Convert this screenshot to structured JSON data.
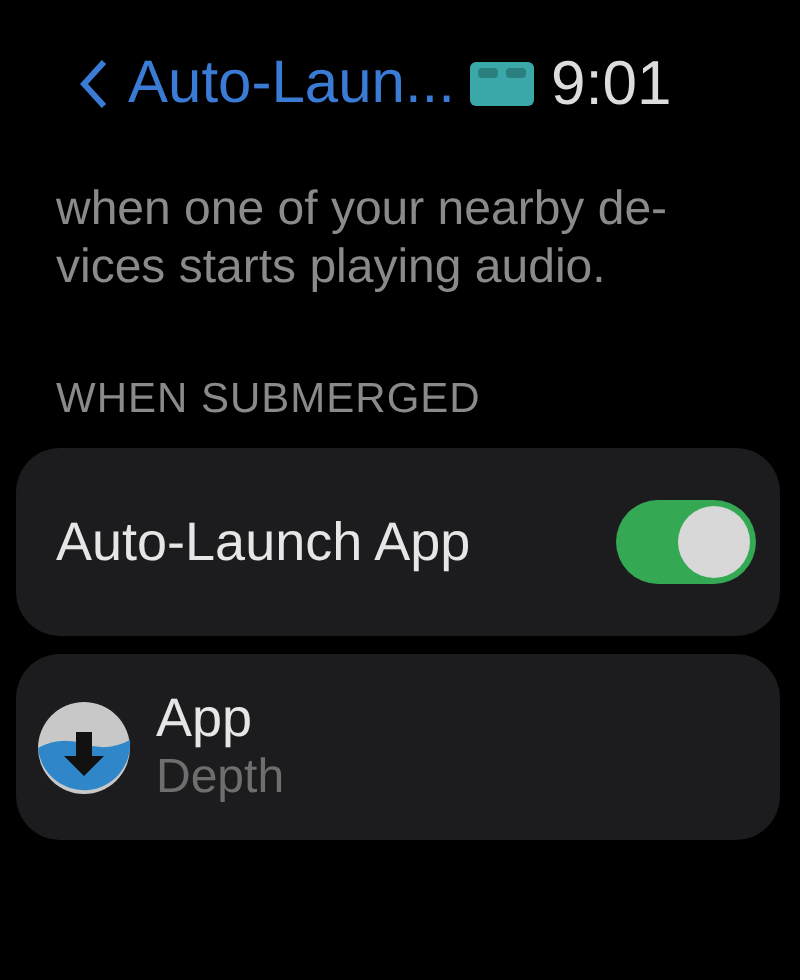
{
  "header": {
    "back_title": "Auto-Laun...",
    "time": "9:01"
  },
  "description": [
    "when one of your nearby de-",
    "vices starts playing audio."
  ],
  "section": {
    "title": "WHEN SUBMERGED"
  },
  "rows": [
    {
      "kind": "toggle",
      "label": "Auto-Launch App",
      "on": true
    },
    {
      "kind": "app",
      "label": "App",
      "value": "Depth"
    }
  ]
}
